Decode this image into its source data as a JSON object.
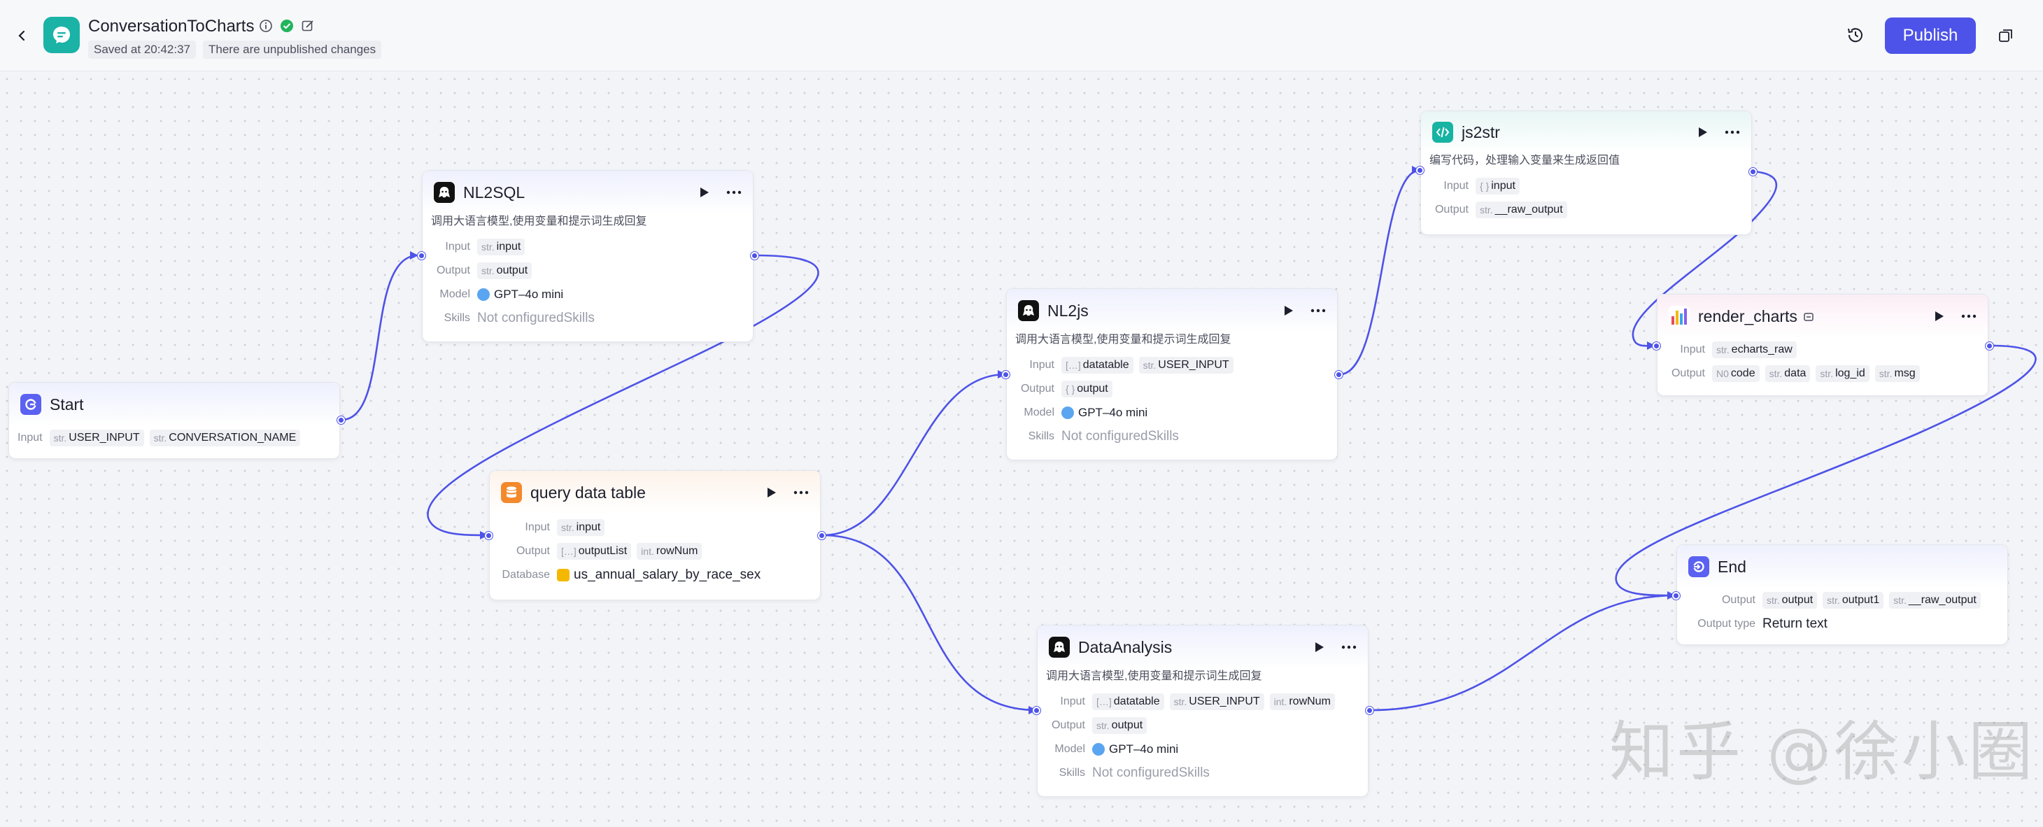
{
  "header": {
    "title": "ConversationToCharts",
    "saved": "Saved at 20:42:37",
    "unpublished": "There are unpublished changes",
    "publish_label": "Publish"
  },
  "colors": {
    "accent": "#4d53e8",
    "edge": "#4d53e8",
    "logo": "#1ab3a6"
  },
  "nodes": {
    "start": {
      "title": "Start",
      "input_label": "Input",
      "inputs": [
        {
          "type": "str.",
          "name": "USER_INPUT"
        },
        {
          "type": "str.",
          "name": "CONVERSATION_NAME"
        }
      ]
    },
    "nl2sql": {
      "title": "NL2SQL",
      "desc": "调用大语言模型,使用变量和提示词生成回复",
      "input_label": "Input",
      "output_label": "Output",
      "model_label": "Model",
      "skills_label": "Skills",
      "input": {
        "type": "str.",
        "name": "input"
      },
      "output": {
        "type": "str.",
        "name": "output"
      },
      "model": "GPT–4o mini",
      "skills": "Not configuredSkills"
    },
    "query": {
      "title": "query data table",
      "input_label": "Input",
      "output_label": "Output",
      "database_label": "Database",
      "input": {
        "type": "str.",
        "name": "input"
      },
      "outputs": [
        {
          "type": "[…]",
          "name": "outputList"
        },
        {
          "type": "int.",
          "name": "rowNum"
        }
      ],
      "database": "us_annual_salary_by_race_sex"
    },
    "nl2js": {
      "title": "NL2js",
      "desc": "调用大语言模型,使用变量和提示词生成回复",
      "input_label": "Input",
      "output_label": "Output",
      "model_label": "Model",
      "skills_label": "Skills",
      "inputs": [
        {
          "type": "[…]",
          "name": "datatable"
        },
        {
          "type": "str.",
          "name": "USER_INPUT"
        }
      ],
      "output": {
        "type": "{ }",
        "name": "output"
      },
      "model": "GPT–4o mini",
      "skills": "Not configuredSkills"
    },
    "js2str": {
      "title": "js2str",
      "desc": "编写代码，处理输入变量来生成返回值",
      "input_label": "Input",
      "output_label": "Output",
      "input": {
        "type": "{ }",
        "name": "input"
      },
      "output": {
        "type": "str.",
        "name": "__raw_output"
      }
    },
    "render": {
      "title": "render_charts",
      "input_label": "Input",
      "output_label": "Output",
      "input": {
        "type": "str.",
        "name": "echarts_raw"
      },
      "outputs": [
        {
          "type": "N0",
          "name": "code"
        },
        {
          "type": "str.",
          "name": "data"
        },
        {
          "type": "str.",
          "name": "log_id"
        },
        {
          "type": "str.",
          "name": "msg"
        }
      ]
    },
    "analysis": {
      "title": "DataAnalysis",
      "desc": "调用大语言模型,使用变量和提示词生成回复",
      "input_label": "Input",
      "output_label": "Output",
      "model_label": "Model",
      "skills_label": "Skills",
      "inputs": [
        {
          "type": "[…]",
          "name": "datatable"
        },
        {
          "type": "str.",
          "name": "USER_INPUT"
        },
        {
          "type": "int.",
          "name": "rowNum"
        }
      ],
      "output": {
        "type": "str.",
        "name": "output"
      },
      "model": "GPT–4o mini",
      "skills": "Not configuredSkills"
    },
    "end": {
      "title": "End",
      "output_label": "Output",
      "output_type_label": "Output type",
      "outputs": [
        {
          "type": "str.",
          "name": "output"
        },
        {
          "type": "str.",
          "name": "output1"
        },
        {
          "type": "str.",
          "name": "__raw_output"
        }
      ],
      "output_type": "Return text"
    }
  },
  "watermark": "知乎 @徐小圈"
}
